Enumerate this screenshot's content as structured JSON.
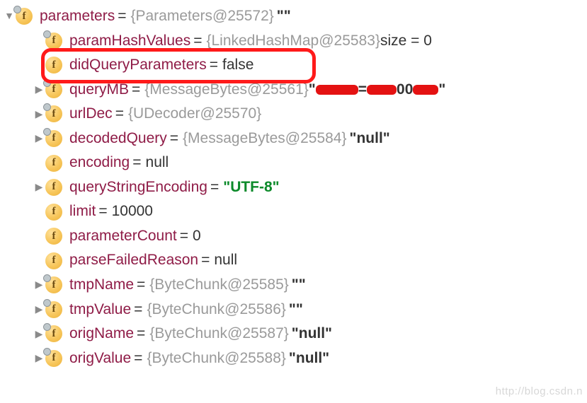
{
  "root": {
    "name": "parameters",
    "obj": "{Parameters@25572}",
    "tail": "\"\""
  },
  "rows": [
    {
      "pin": true,
      "arrow": "",
      "name": "paramHashValues",
      "obj": "{LinkedHashMap@25583}",
      "tailPlain": "  size = 0"
    },
    {
      "pin": false,
      "arrow": "",
      "name": "didQueryParameters",
      "valPlain": "false"
    },
    {
      "pin": true,
      "arrow": "right",
      "name": "queryMB",
      "obj": "{MessageBytes@25561}"
    },
    {
      "pin": true,
      "arrow": "right",
      "name": "urlDec",
      "obj": "{UDecoder@25570}"
    },
    {
      "pin": true,
      "arrow": "right",
      "name": "decodedQuery",
      "obj": "{MessageBytes@25584}",
      "tailBold": "\"null\""
    },
    {
      "pin": false,
      "arrow": "",
      "name": "encoding",
      "valPlain": "null"
    },
    {
      "pin": false,
      "arrow": "right",
      "name": "queryStringEncoding",
      "valGreen": "\"UTF-8\""
    },
    {
      "pin": false,
      "arrow": "",
      "name": "limit",
      "valPlain": "10000"
    },
    {
      "pin": false,
      "arrow": "",
      "name": "parameterCount",
      "valPlain": "0"
    },
    {
      "pin": false,
      "arrow": "",
      "name": "parseFailedReason",
      "valPlain": "null"
    },
    {
      "pin": true,
      "arrow": "right",
      "name": "tmpName",
      "obj": "{ByteChunk@25585}",
      "tailBold": "\"\""
    },
    {
      "pin": true,
      "arrow": "right",
      "name": "tmpValue",
      "obj": "{ByteChunk@25586}",
      "tailBold": "\"\""
    },
    {
      "pin": true,
      "arrow": "right",
      "name": "origName",
      "obj": "{ByteChunk@25587}",
      "tailBold": "\"null\""
    },
    {
      "pin": true,
      "arrow": "right",
      "name": "origValue",
      "obj": "{ByteChunk@25588}",
      "tailBold": "\"null\""
    }
  ],
  "queryMB_tail": {
    "quoteOpen": " \"",
    "mid": "=",
    "post": "00",
    "quoteClose": "\""
  },
  "watermark": "http://blog.csdn.n"
}
